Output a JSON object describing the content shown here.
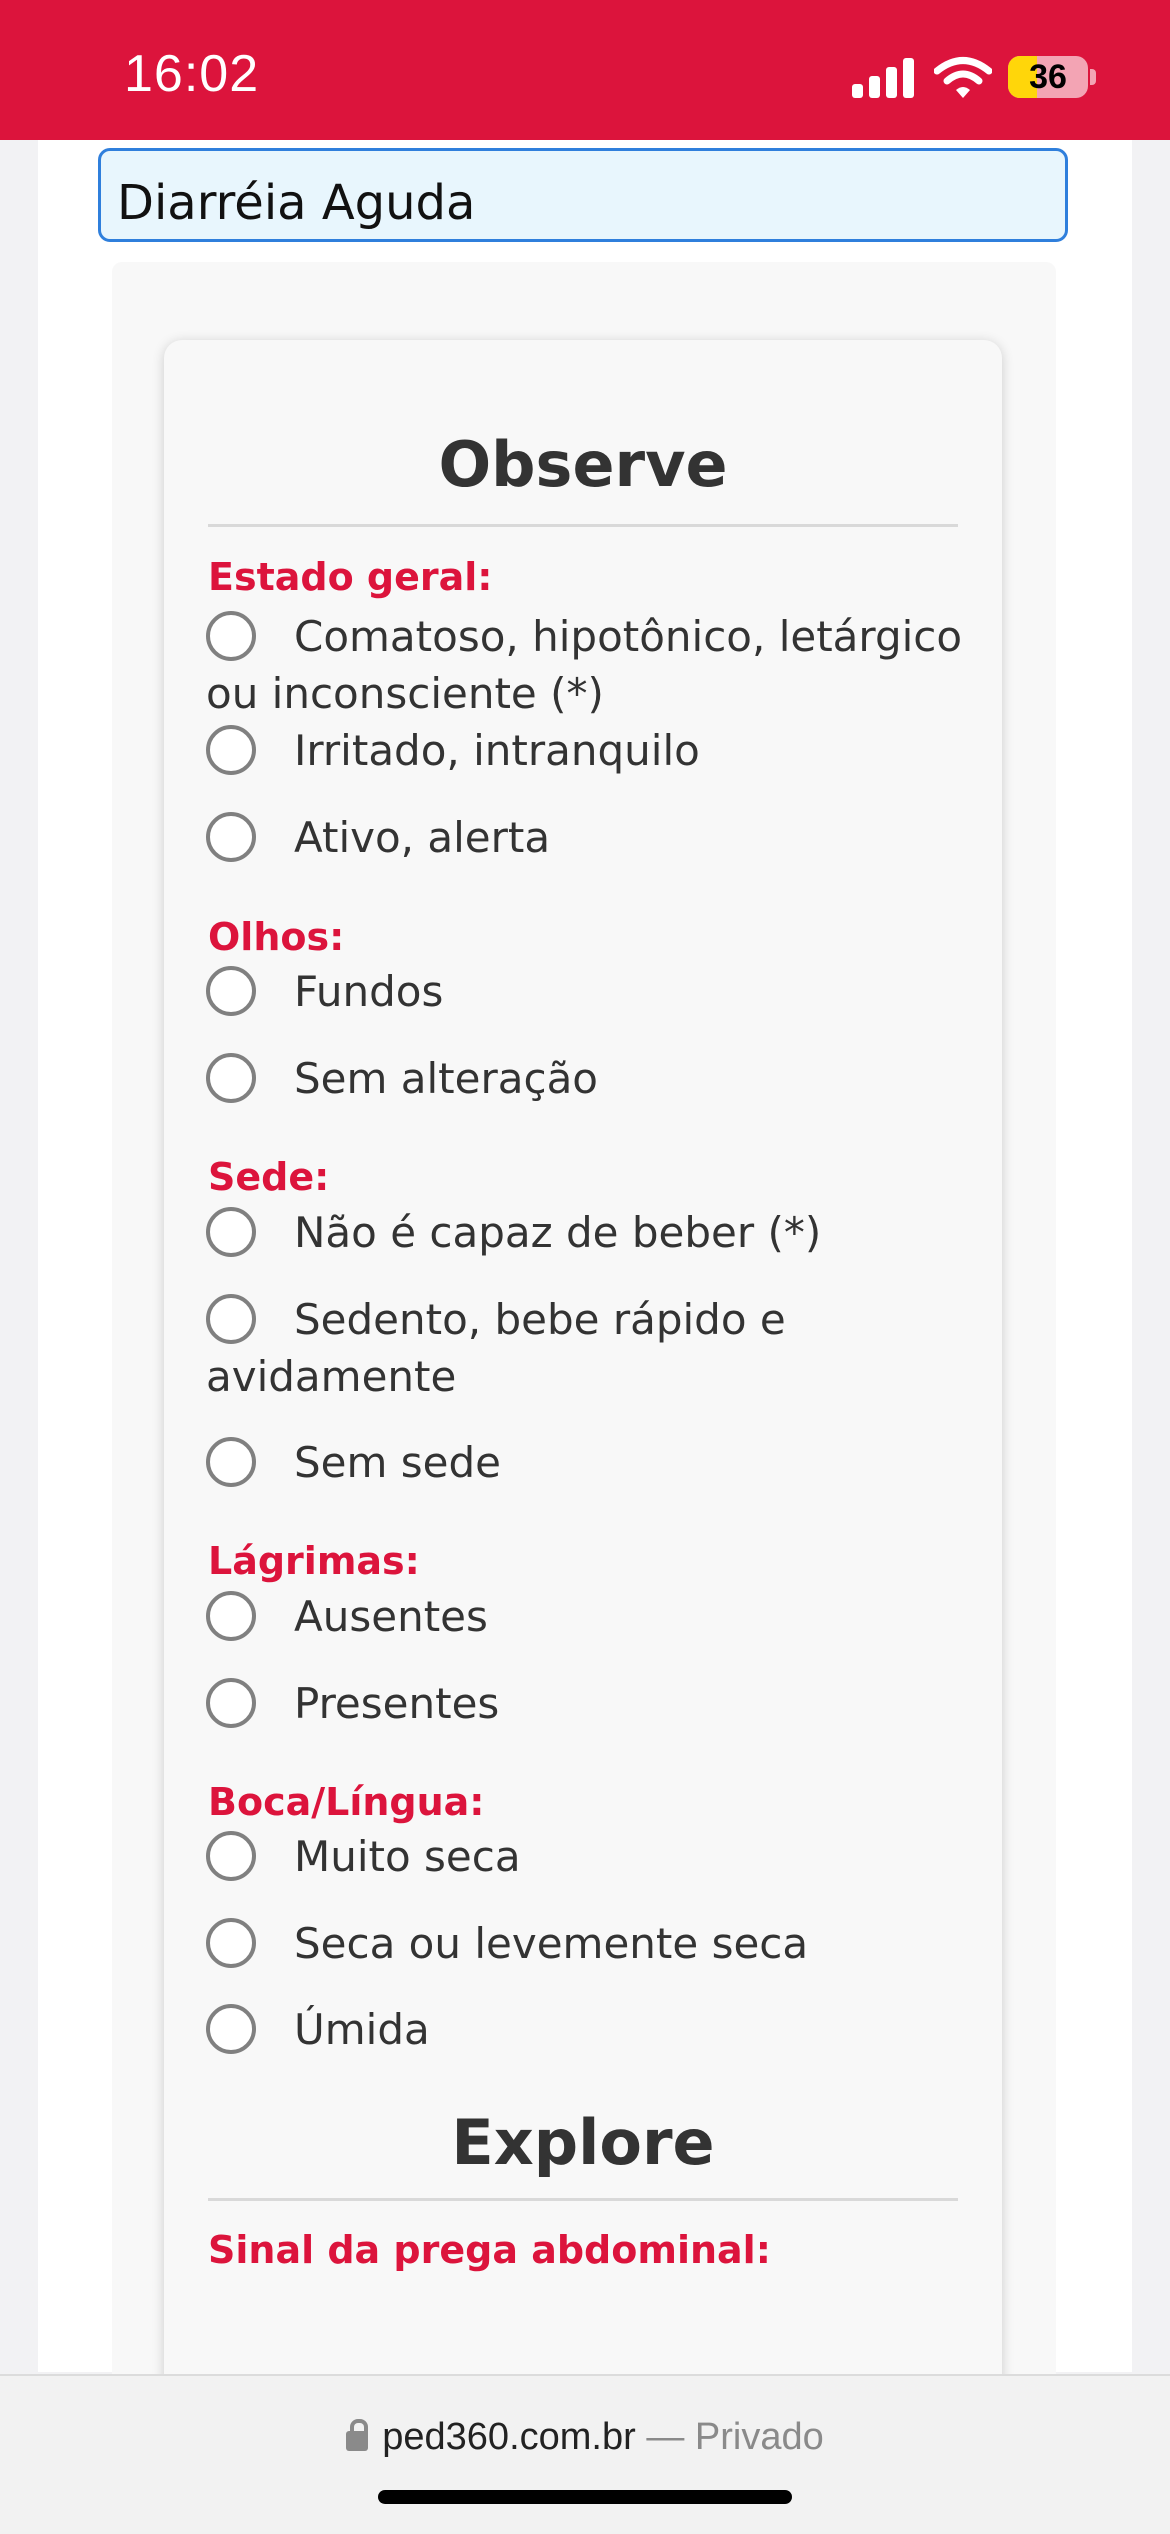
{
  "status_bar": {
    "time": "16:02",
    "battery_pct": "36",
    "battery_level": 0.36,
    "icons": [
      "signal-icon",
      "wifi-icon",
      "battery-icon"
    ],
    "background": "#dc143c"
  },
  "condition_select": {
    "value": "Diarréia Aguda"
  },
  "sections": {
    "observe_title": "Observe",
    "explore_title": "Explore"
  },
  "questions": {
    "estado_geral": {
      "label": "Estado geral:",
      "options": [
        "Comatoso, hipotônico, letárgico ou inconsciente (*)",
        "Irritado, intranquilo",
        "Ativo, alerta"
      ]
    },
    "olhos": {
      "label": "Olhos:",
      "options": [
        "Fundos",
        "Sem alteração"
      ]
    },
    "sede": {
      "label": "Sede:",
      "options": [
        "Não é capaz de beber (*)",
        "Sedento, bebe rápido e avidamente",
        "Sem sede"
      ]
    },
    "lagrimas": {
      "label": "Lágrimas:",
      "options": [
        "Ausentes",
        "Presentes"
      ]
    },
    "boca_lingua": {
      "label": "Boca/Língua:",
      "options": [
        "Muito seca",
        "Seca ou levemente seca",
        "Úmida"
      ]
    },
    "prega_abdominal": {
      "label": "Sinal da prega abdominal:"
    }
  },
  "browser_bar": {
    "domain": "ped360.com.br",
    "suffix": "— Privado",
    "icon": "lock-icon"
  },
  "colors": {
    "accent": "#dc143c",
    "select_border": "#2f7fdc",
    "select_fill": "#e8f6fd"
  }
}
